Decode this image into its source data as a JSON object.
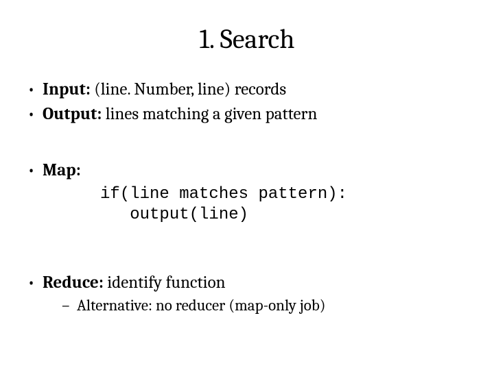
{
  "title": "1. Search",
  "bullets": {
    "input": {
      "label": "Input:",
      "text": " (line. Number, line) records"
    },
    "output": {
      "label": "Output:",
      "text": " lines matching a given pattern"
    },
    "map": {
      "label": "Map:"
    },
    "reduce": {
      "label": "Reduce:",
      "text": " identify function"
    }
  },
  "code": {
    "line1": "if(line matches pattern):",
    "line2": "   output(line)"
  },
  "sub": {
    "alt": {
      "label": "Alternative:",
      "text": " no reducer (map-only job)"
    }
  }
}
